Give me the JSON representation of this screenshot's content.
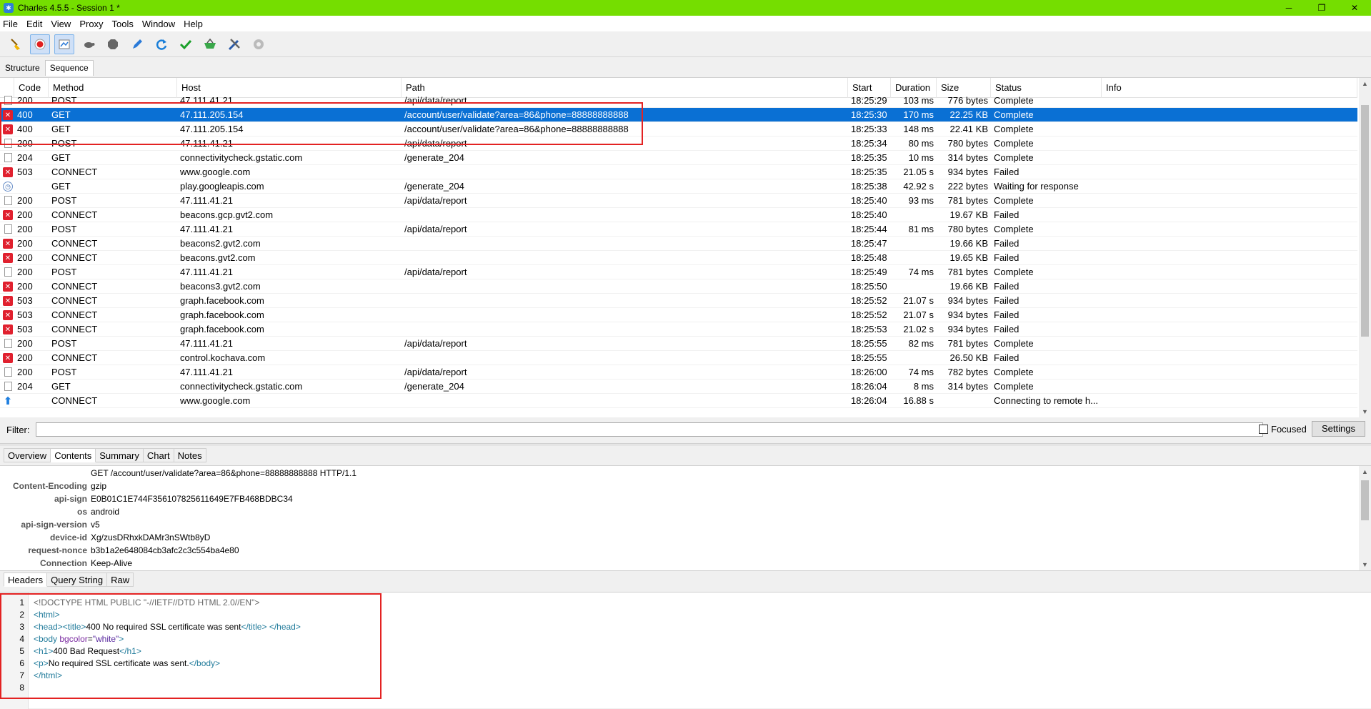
{
  "window": {
    "title": "Charles 4.5.5 - Session 1 *",
    "controls": [
      "─",
      "❐",
      "✕"
    ]
  },
  "menu": [
    "File",
    "Edit",
    "View",
    "Proxy",
    "Tools",
    "Window",
    "Help"
  ],
  "toolbar_icons": [
    "broom-icon",
    "record-icon",
    "throttle-icon",
    "turtle-icon",
    "stop-icon",
    "pen-icon",
    "refresh-icon",
    "check-icon",
    "basket-icon",
    "tools-icon",
    "settings-gear-icon"
  ],
  "view_tabs": [
    "Structure",
    "Sequence"
  ],
  "columns": [
    "Code",
    "Method",
    "Host",
    "Path",
    "Start",
    "Duration",
    "Size",
    "Status",
    "Info"
  ],
  "rows": [
    {
      "icon": "doc",
      "code": "200",
      "method": "POST",
      "host": "47.111.41.21",
      "path": "/api/data/report",
      "start": "18:25:29",
      "duration": "103 ms",
      "size": "776 bytes",
      "status": "Complete"
    },
    {
      "icon": "err",
      "code": "400",
      "method": "GET",
      "host": "47.111.205.154",
      "path": "/account/user/validate?area=86&phone=88888888888",
      "start": "18:25:30",
      "duration": "170 ms",
      "size": "22.25 KB",
      "status": "Complete",
      "selected": true
    },
    {
      "icon": "err",
      "code": "400",
      "method": "GET",
      "host": "47.111.205.154",
      "path": "/account/user/validate?area=86&phone=88888888888",
      "start": "18:25:33",
      "duration": "148 ms",
      "size": "22.41 KB",
      "status": "Complete"
    },
    {
      "icon": "doc",
      "code": "200",
      "method": "POST",
      "host": "47.111.41.21",
      "path": "/api/data/report",
      "start": "18:25:34",
      "duration": "80 ms",
      "size": "780 bytes",
      "status": "Complete"
    },
    {
      "icon": "doc",
      "code": "204",
      "method": "GET",
      "host": "connectivitycheck.gstatic.com",
      "path": "/generate_204",
      "start": "18:25:35",
      "duration": "10 ms",
      "size": "314 bytes",
      "status": "Complete"
    },
    {
      "icon": "err",
      "code": "503",
      "method": "CONNECT",
      "host": "www.google.com",
      "path": "",
      "start": "18:25:35",
      "duration": "21.05 s",
      "size": "934 bytes",
      "status": "Failed"
    },
    {
      "icon": "clock",
      "code": "",
      "method": "GET",
      "host": "play.googleapis.com",
      "path": "/generate_204",
      "start": "18:25:38",
      "duration": "42.92 s",
      "size": "222 bytes",
      "status": "Waiting for response"
    },
    {
      "icon": "doc",
      "code": "200",
      "method": "POST",
      "host": "47.111.41.21",
      "path": "/api/data/report",
      "start": "18:25:40",
      "duration": "93 ms",
      "size": "781 bytes",
      "status": "Complete"
    },
    {
      "icon": "err",
      "code": "200",
      "method": "CONNECT",
      "host": "beacons.gcp.gvt2.com",
      "path": "",
      "start": "18:25:40",
      "duration": "",
      "size": "19.67 KB",
      "status": "Failed"
    },
    {
      "icon": "doc",
      "code": "200",
      "method": "POST",
      "host": "47.111.41.21",
      "path": "/api/data/report",
      "start": "18:25:44",
      "duration": "81 ms",
      "size": "780 bytes",
      "status": "Complete"
    },
    {
      "icon": "err",
      "code": "200",
      "method": "CONNECT",
      "host": "beacons2.gvt2.com",
      "path": "",
      "start": "18:25:47",
      "duration": "",
      "size": "19.66 KB",
      "status": "Failed"
    },
    {
      "icon": "err",
      "code": "200",
      "method": "CONNECT",
      "host": "beacons.gvt2.com",
      "path": "",
      "start": "18:25:48",
      "duration": "",
      "size": "19.65 KB",
      "status": "Failed"
    },
    {
      "icon": "doc",
      "code": "200",
      "method": "POST",
      "host": "47.111.41.21",
      "path": "/api/data/report",
      "start": "18:25:49",
      "duration": "74 ms",
      "size": "781 bytes",
      "status": "Complete"
    },
    {
      "icon": "err",
      "code": "200",
      "method": "CONNECT",
      "host": "beacons3.gvt2.com",
      "path": "",
      "start": "18:25:50",
      "duration": "",
      "size": "19.66 KB",
      "status": "Failed"
    },
    {
      "icon": "err",
      "code": "503",
      "method": "CONNECT",
      "host": "graph.facebook.com",
      "path": "",
      "start": "18:25:52",
      "duration": "21.07 s",
      "size": "934 bytes",
      "status": "Failed"
    },
    {
      "icon": "err",
      "code": "503",
      "method": "CONNECT",
      "host": "graph.facebook.com",
      "path": "",
      "start": "18:25:52",
      "duration": "21.07 s",
      "size": "934 bytes",
      "status": "Failed"
    },
    {
      "icon": "err",
      "code": "503",
      "method": "CONNECT",
      "host": "graph.facebook.com",
      "path": "",
      "start": "18:25:53",
      "duration": "21.02 s",
      "size": "934 bytes",
      "status": "Failed"
    },
    {
      "icon": "doc",
      "code": "200",
      "method": "POST",
      "host": "47.111.41.21",
      "path": "/api/data/report",
      "start": "18:25:55",
      "duration": "82 ms",
      "size": "781 bytes",
      "status": "Complete"
    },
    {
      "icon": "err",
      "code": "200",
      "method": "CONNECT",
      "host": "control.kochava.com",
      "path": "",
      "start": "18:25:55",
      "duration": "",
      "size": "26.50 KB",
      "status": "Failed"
    },
    {
      "icon": "doc",
      "code": "200",
      "method": "POST",
      "host": "47.111.41.21",
      "path": "/api/data/report",
      "start": "18:26:00",
      "duration": "74 ms",
      "size": "782 bytes",
      "status": "Complete"
    },
    {
      "icon": "doc",
      "code": "204",
      "method": "GET",
      "host": "connectivitycheck.gstatic.com",
      "path": "/generate_204",
      "start": "18:26:04",
      "duration": "8 ms",
      "size": "314 bytes",
      "status": "Complete"
    },
    {
      "icon": "up",
      "code": "",
      "method": "CONNECT",
      "host": "www.google.com",
      "path": "",
      "start": "18:26:04",
      "duration": "16.88 s",
      "size": "",
      "status": "Connecting to remote h..."
    }
  ],
  "filter": {
    "label": "Filter:",
    "value": "",
    "focused_label": "Focused",
    "settings_label": "Settings"
  },
  "detail_tabs": [
    "Overview",
    "Contents",
    "Summary",
    "Chart",
    "Notes"
  ],
  "request_line": "GET /account/user/validate?area=86&phone=88888888888 HTTP/1.1",
  "headers": [
    {
      "key": "Content-Encoding",
      "value": "gzip"
    },
    {
      "key": "api-sign",
      "value": "E0B01C1E744F356107825611649E7FB468BDBC34"
    },
    {
      "key": "os",
      "value": "android"
    },
    {
      "key": "api-sign-version",
      "value": "v5"
    },
    {
      "key": "device-id",
      "value": "Xg/zusDRhxkDAMr3nSWtb8yD"
    },
    {
      "key": "request-nonce",
      "value": "b3b1a2e648084cb3afc2c3c554ba4e80"
    },
    {
      "key": "Connection",
      "value": "Keep-Alive"
    }
  ],
  "request_tabs": [
    "Headers",
    "Query String",
    "Raw"
  ],
  "response_lines": [
    {
      "n": "1",
      "parts": [
        {
          "t": "<!DOCTYPE HTML PUBLIC \"-//IETF//DTD HTML 2.0//EN\">",
          "c": "dt"
        }
      ]
    },
    {
      "n": "2",
      "parts": [
        {
          "t": "<html>",
          "c": "tag"
        }
      ]
    },
    {
      "n": "3",
      "parts": [
        {
          "t": "<head>",
          "c": "tag"
        },
        {
          "t": "<title>",
          "c": "tag"
        },
        {
          "t": "400 No required SSL certificate was sent",
          "c": ""
        },
        {
          "t": "</title>",
          "c": "tag"
        },
        {
          "t": " ",
          "c": ""
        },
        {
          "t": "</head>",
          "c": "tag"
        }
      ]
    },
    {
      "n": "4",
      "parts": [
        {
          "t": "<body ",
          "c": "tag"
        },
        {
          "t": "bgcolor",
          "c": "attr"
        },
        {
          "t": "=",
          "c": ""
        },
        {
          "t": "\"white\"",
          "c": "str"
        },
        {
          "t": ">",
          "c": "tag"
        }
      ]
    },
    {
      "n": "5",
      "parts": [
        {
          "t": "<h1>",
          "c": "tag"
        },
        {
          "t": "400 Bad Request",
          "c": ""
        },
        {
          "t": "</h1>",
          "c": "tag"
        }
      ]
    },
    {
      "n": "6",
      "parts": [
        {
          "t": "<p>",
          "c": "tag"
        },
        {
          "t": "No required SSL certificate was sent.",
          "c": ""
        },
        {
          "t": "</body>",
          "c": "tag"
        }
      ]
    },
    {
      "n": "7",
      "parts": [
        {
          "t": "</html>",
          "c": "tag"
        }
      ]
    },
    {
      "n": "8",
      "parts": []
    }
  ]
}
